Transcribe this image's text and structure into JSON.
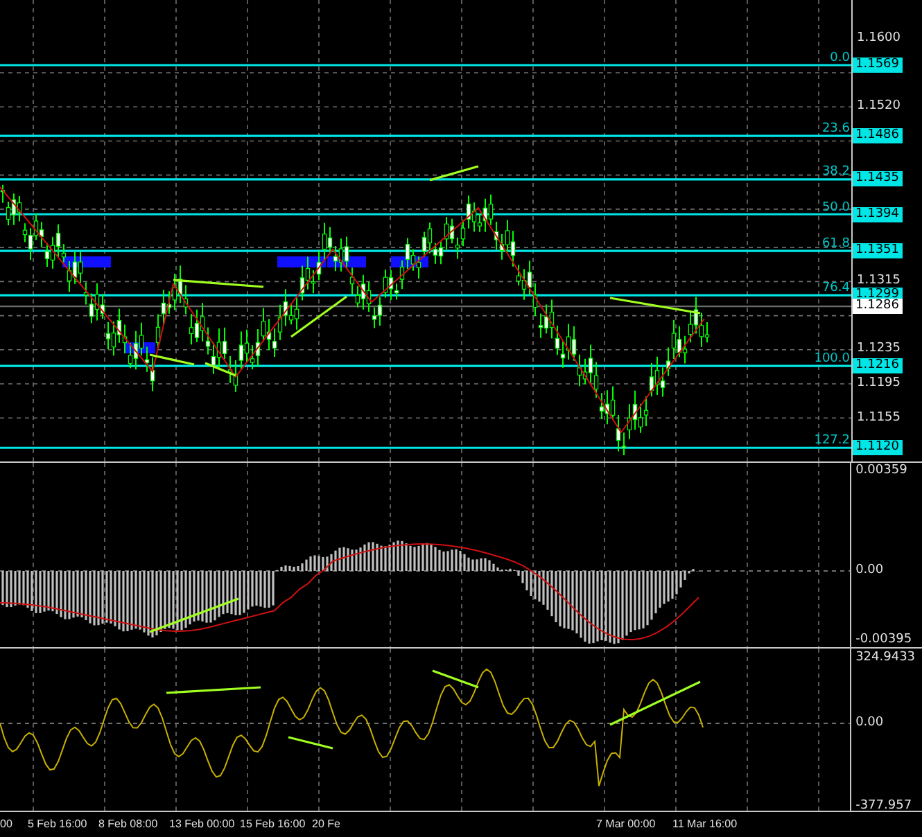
{
  "price_axis": {
    "ticks": [
      "1.1600",
      "1.1520",
      "1.1315",
      "1.1235",
      "1.1195",
      "1.1155"
    ],
    "levels": [
      {
        "kind": "fib",
        "label": "0.0",
        "price": "1.1569"
      },
      {
        "kind": "fib",
        "label": "23.6",
        "price": "1.1486"
      },
      {
        "kind": "fib",
        "label": "38.2",
        "price": "1.1435"
      },
      {
        "kind": "fib",
        "label": "50.0",
        "price": "1.1394"
      },
      {
        "kind": "fib",
        "label": "61.8",
        "price": "1.1351"
      },
      {
        "kind": "fib",
        "label": "76.4",
        "price": "1.1299"
      },
      {
        "kind": "current",
        "price": "1.1286"
      },
      {
        "kind": "fib",
        "label": "100.0",
        "price": "1.1216"
      },
      {
        "kind": "fib",
        "label": "127.2",
        "price": "1.1120"
      }
    ]
  },
  "macd_pane": {
    "labels": [
      "0.00359",
      "0.00",
      "-0.00395"
    ]
  },
  "oscillator_pane": {
    "labels": [
      "324.9433",
      "0.00",
      "-377.957"
    ]
  },
  "time_axis": {
    "labels": [
      "00",
      "5 Feb 16:00",
      "8 Feb 08:00",
      "13 Feb 00:00",
      "15 Feb 16:00",
      "20 Fe",
      "7 Mar 00:00",
      "11 Mar 16:00"
    ]
  }
}
